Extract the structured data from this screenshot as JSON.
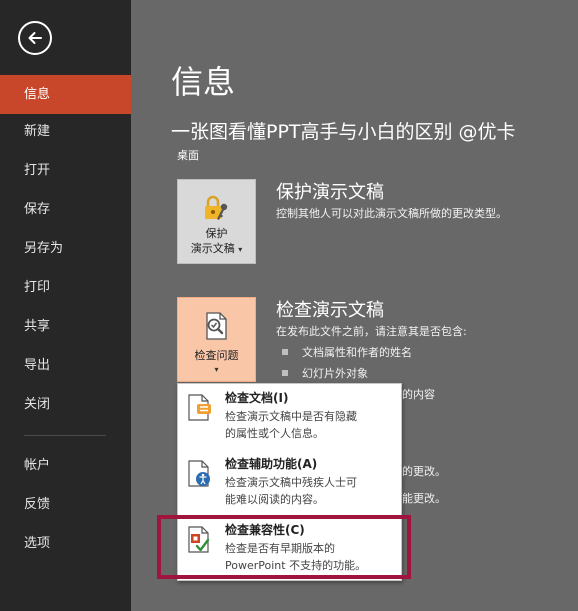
{
  "sidebar": {
    "back_icon": "back-arrow-icon",
    "items": [
      {
        "label": "信息",
        "active": true
      },
      {
        "label": "新建"
      },
      {
        "label": "打开"
      },
      {
        "label": "保存"
      },
      {
        "label": "另存为"
      },
      {
        "label": "打印"
      },
      {
        "label": "共享"
      },
      {
        "label": "导出"
      },
      {
        "label": "关闭"
      }
    ],
    "bottom_items": [
      {
        "label": "帐户"
      },
      {
        "label": "反馈"
      },
      {
        "label": "选项"
      }
    ],
    "active_color": "#c8472b"
  },
  "main": {
    "page_title": "信息",
    "doc_title": "一张图看懂PPT高手与小白的区别 @优卡",
    "doc_location": "桌面",
    "protect": {
      "button_line1": "保护",
      "button_line2": "演示文稿",
      "title": "保护演示文稿",
      "description": "控制其他人可以对此演示文稿所做的更改类型。",
      "icon": "lock-key-icon"
    },
    "inspect": {
      "button_label": "检查问题",
      "title": "检查演示文稿",
      "description": "在发布此文件之前，请注意其是否包含:",
      "bullets": [
        "文档属性和作者的姓名",
        "幻灯片外对象"
      ],
      "partial_texts": [
        "的内容",
        "的更改。",
        "能更改。"
      ],
      "icon": "inspect-document-icon"
    }
  },
  "dropdown": {
    "items": [
      {
        "title": "检查文档(I)",
        "desc1": "检查演示文稿中是否有隐藏",
        "desc2": "的属性或个人信息。",
        "icon": "inspect-document-icon"
      },
      {
        "title": "检查辅助功能(A)",
        "desc1": "检查演示文稿中残疾人士可",
        "desc2": "能难以阅读的内容。",
        "icon": "accessibility-icon"
      },
      {
        "title": "检查兼容性(C)",
        "desc1": "检查是否有早期版本的",
        "desc2": "PowerPoint 不支持的功能。",
        "icon": "compatibility-icon"
      }
    ],
    "highlight_color": "#a0153e"
  }
}
